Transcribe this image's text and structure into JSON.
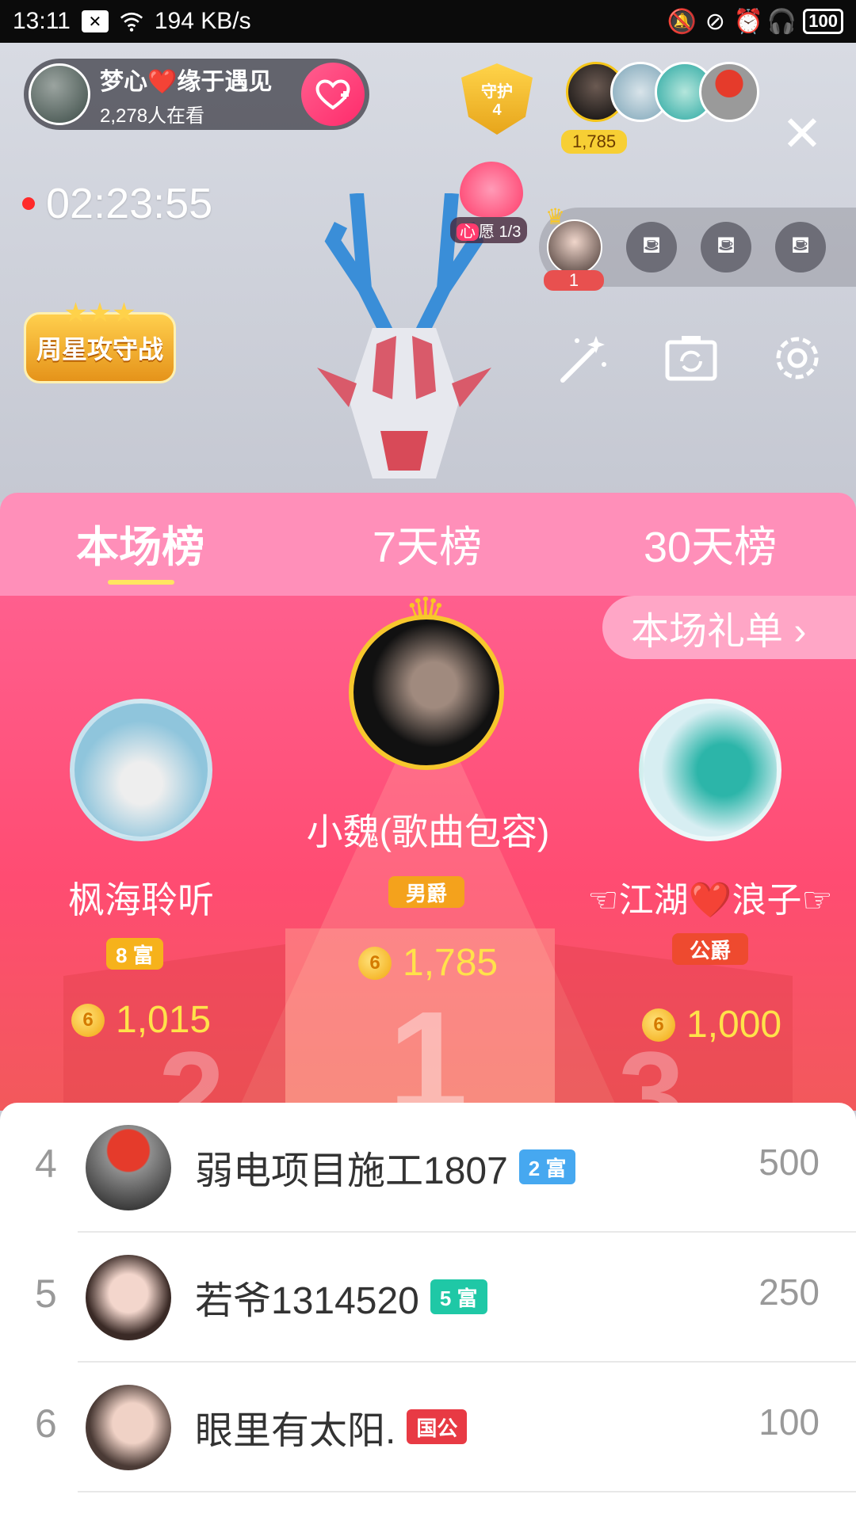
{
  "status_bar": {
    "time": "13:11",
    "network_speed": "194 KB/s",
    "battery": "100"
  },
  "host": {
    "name": "梦心❤️缘于遇见",
    "viewers": "2,278人在看",
    "follow_icon": "heart-plus-icon"
  },
  "guard": {
    "label": "守护",
    "count": "4"
  },
  "audience": {
    "top_count": "1,785"
  },
  "timer": "02:23:55",
  "wish": {
    "label_char": "心",
    "label_text": "愿 1/3"
  },
  "seat": {
    "count": "1"
  },
  "star_battle": {
    "label": "周星攻守战"
  },
  "tabs": [
    "本场榜",
    "7天榜",
    "30天榜"
  ],
  "gift_list_label": "本场礼单 ›",
  "podium": [
    {
      "rank": 2,
      "name": "枫海聆听",
      "badge": "8 富",
      "badge_color": "#f6b21b",
      "coins": "1,015"
    },
    {
      "rank": 1,
      "name": "小魏(歌曲包容)",
      "badge": "男爵",
      "badge_color": "#f4a21c",
      "coins": "1,785"
    },
    {
      "rank": 3,
      "name": "☜江湖❤️浪子☞",
      "badge": "公爵",
      "badge_color": "#ee4a2f",
      "coins": "1,000"
    }
  ],
  "list": [
    {
      "rank": "4",
      "name": "弱电项目施工1807",
      "badge": "2 富",
      "badge_color": "#46a8f0",
      "score": "500"
    },
    {
      "rank": "5",
      "name": "若爷1314520",
      "badge": "5 富",
      "badge_color": "#1fc8a6",
      "score": "250"
    },
    {
      "rank": "6",
      "name": "眼里有太阳.",
      "badge": "国公",
      "badge_color": "#e83a44",
      "score": "100"
    }
  ],
  "colors": {
    "tab_bar": "#ff8fb9",
    "podium_bg": "#ff5f8e",
    "coin_text": "#ffe24a",
    "tab_indicator": "#ffe560"
  }
}
